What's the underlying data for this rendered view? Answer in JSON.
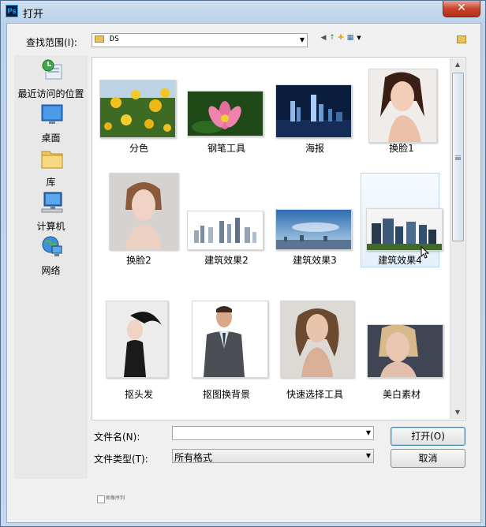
{
  "window": {
    "title": "打开",
    "app_icon_text": "Ps",
    "close_glyph": "✕"
  },
  "lookin": {
    "label": "查找范围(I):",
    "value": "DS"
  },
  "places": [
    {
      "label": "最近访问的位置",
      "icon": "recent-places-icon"
    },
    {
      "label": "桌面",
      "icon": "desktop-icon"
    },
    {
      "label": "库",
      "icon": "libraries-icon"
    },
    {
      "label": "计算机",
      "icon": "computer-icon"
    },
    {
      "label": "网络",
      "icon": "network-icon"
    }
  ],
  "files": [
    {
      "label": "分色"
    },
    {
      "label": "钢笔工具"
    },
    {
      "label": "海报"
    },
    {
      "label": "换脸1"
    },
    {
      "label": "换脸2"
    },
    {
      "label": "建筑效果2"
    },
    {
      "label": "建筑效果3"
    },
    {
      "label": "建筑效果4"
    },
    {
      "label": "抠头发"
    },
    {
      "label": "抠图换背景"
    },
    {
      "label": "快速选择工具"
    },
    {
      "label": "美白素材"
    }
  ],
  "selected_file": "建筑效果4",
  "filename": {
    "label": "文件名(N):",
    "value": ""
  },
  "filetype": {
    "label": "文件类型(T):",
    "value": "所有格式"
  },
  "buttons": {
    "open": "打开(O)",
    "cancel": "取消"
  },
  "image_sequence": {
    "label": "图像序列",
    "checked": false
  },
  "colors": {
    "close_button": "#c7432b",
    "selection_border": "#b8d6fb",
    "title_bar": "#b9d1ea"
  }
}
